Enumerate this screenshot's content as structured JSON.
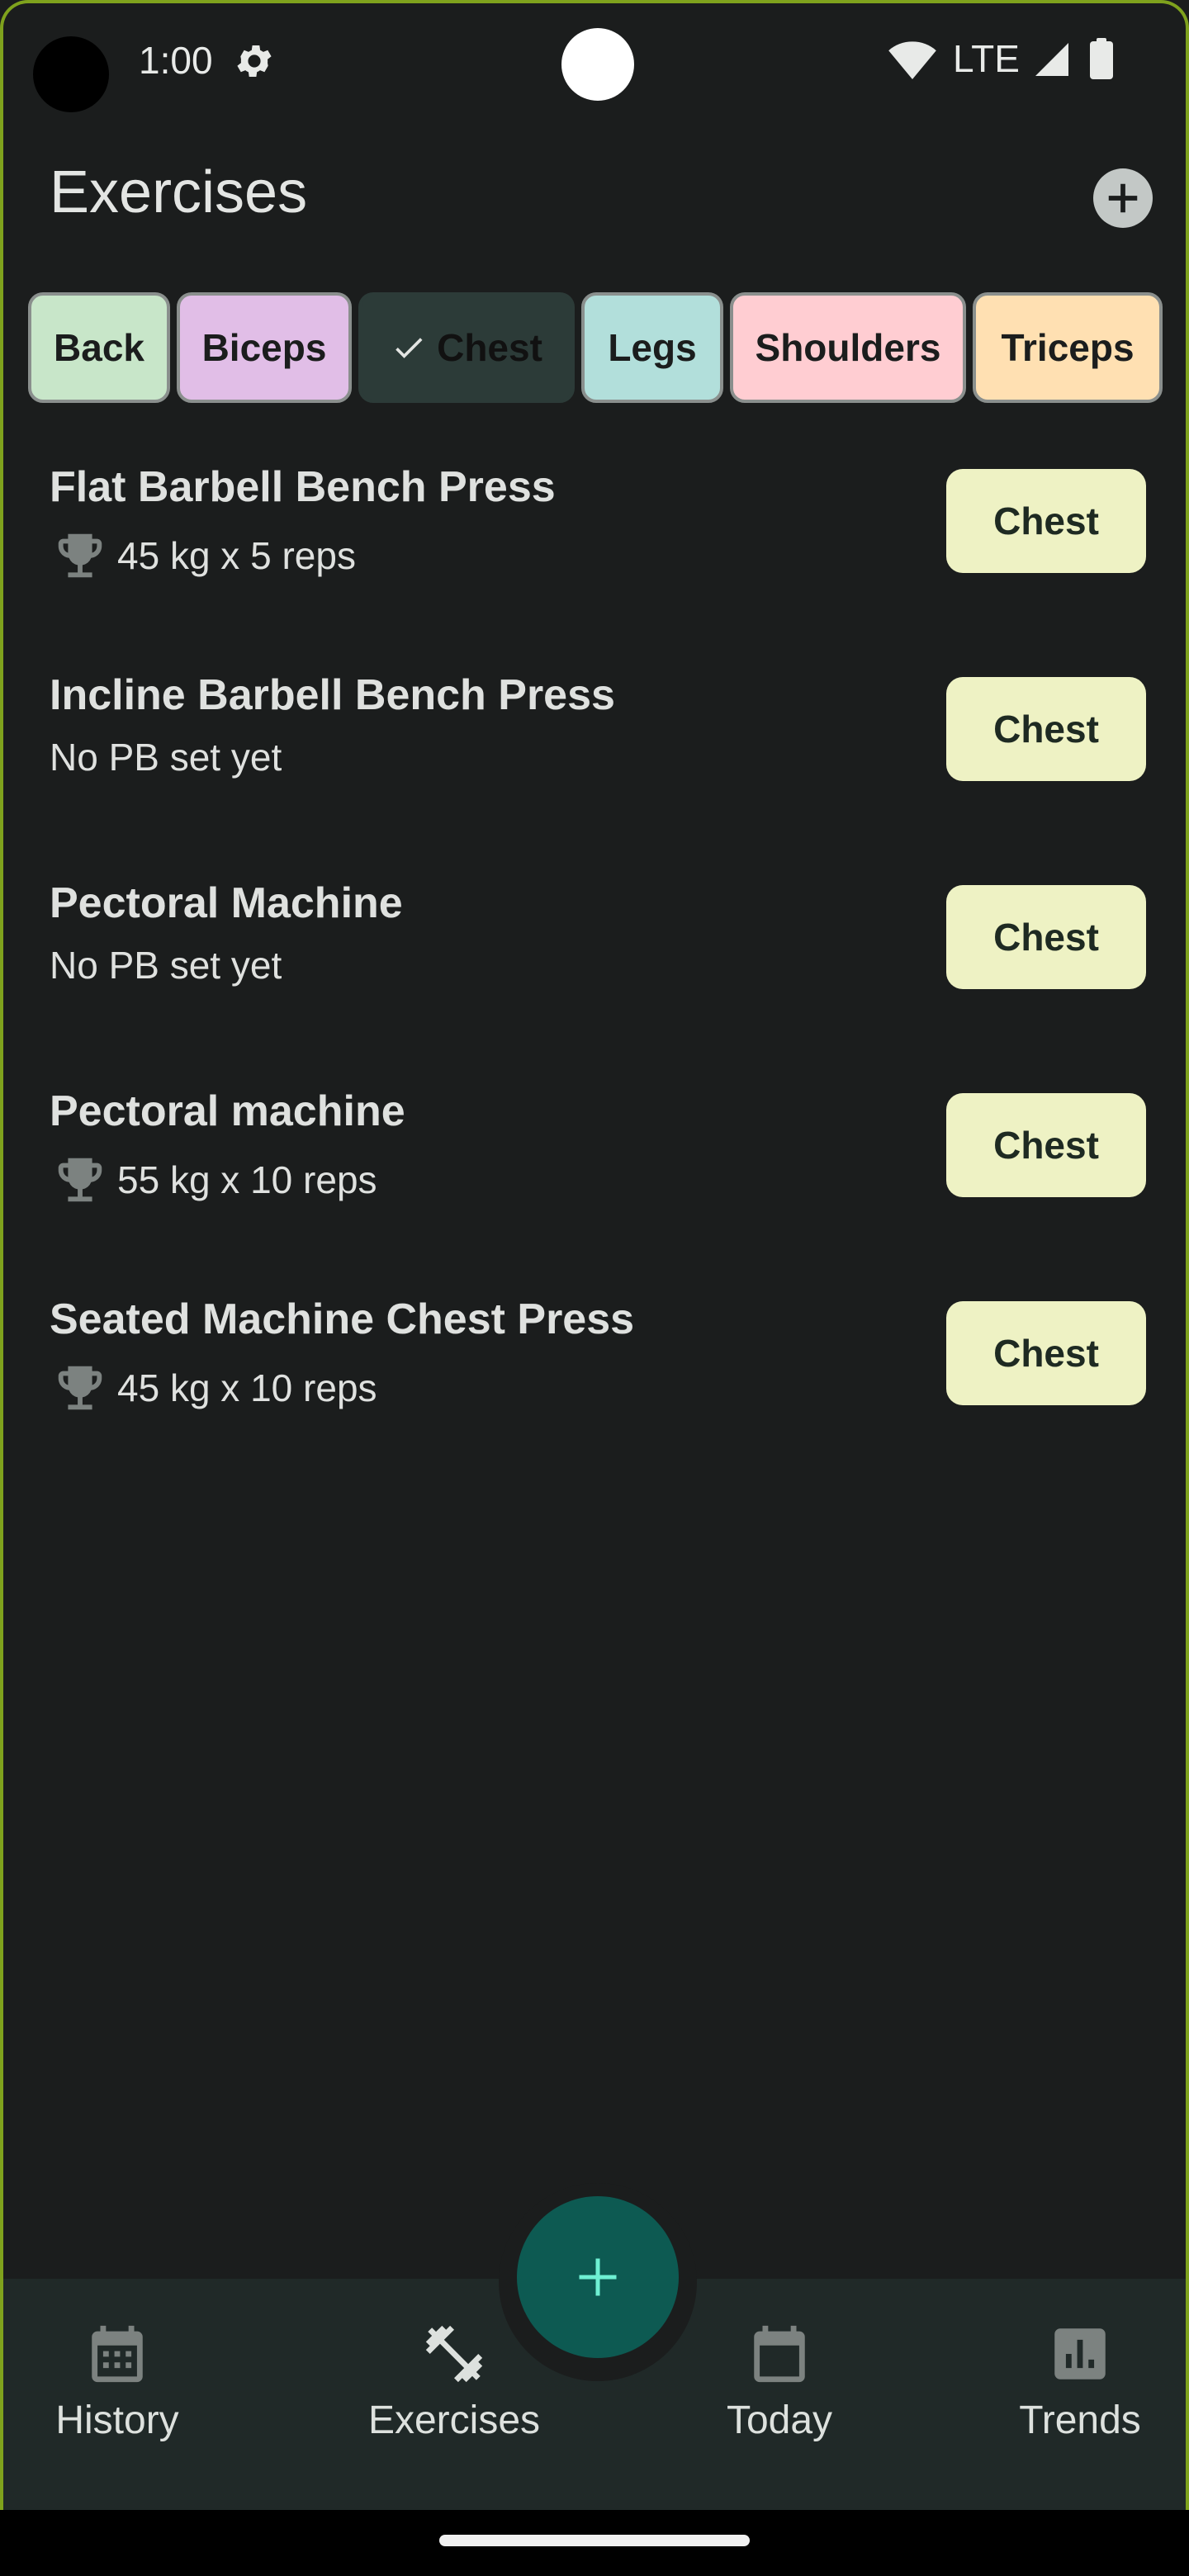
{
  "status_bar": {
    "time": "1:00",
    "network": "LTE"
  },
  "app_bar": {
    "title": "Exercises"
  },
  "filters": [
    {
      "label": "Back",
      "color": "#c8e6c9",
      "selected": false
    },
    {
      "label": "Biceps",
      "color": "#e1bee7",
      "selected": false
    },
    {
      "label": "Chest",
      "color": "#2c3b38",
      "selected": true
    },
    {
      "label": "Legs",
      "color": "#b2dfdb",
      "selected": false
    },
    {
      "label": "Shoulders",
      "color": "#ffcdd2",
      "selected": false
    },
    {
      "label": "Triceps",
      "color": "#ffe0b2",
      "selected": false
    }
  ],
  "exercises": [
    {
      "name": "Flat Barbell Bench Press",
      "pb": "45 kg x 5 reps",
      "has_pb": true,
      "tag": "Chest"
    },
    {
      "name": "Incline Barbell Bench Press",
      "pb": "No PB set yet",
      "has_pb": false,
      "tag": "Chest"
    },
    {
      "name": "Pectoral Machine",
      "pb": "No PB set yet",
      "has_pb": false,
      "tag": "Chest"
    },
    {
      "name": "Pectoral machine",
      "pb": "55 kg x 10 reps",
      "has_pb": true,
      "tag": "Chest"
    },
    {
      "name": "Seated Machine Chest Press",
      "pb": "45 kg x 10 reps",
      "has_pb": true,
      "tag": "Chest"
    }
  ],
  "nav": {
    "history": "History",
    "exercises": "Exercises",
    "today": "Today",
    "trends": "Trends"
  },
  "icons": {
    "trophy": "trophy-icon",
    "fab": "plus-icon",
    "add": "add-circle-icon"
  },
  "colors": {
    "accent": "#0d5a52",
    "tag_bg": "#eef2c4",
    "frame": "#7fa21d"
  }
}
